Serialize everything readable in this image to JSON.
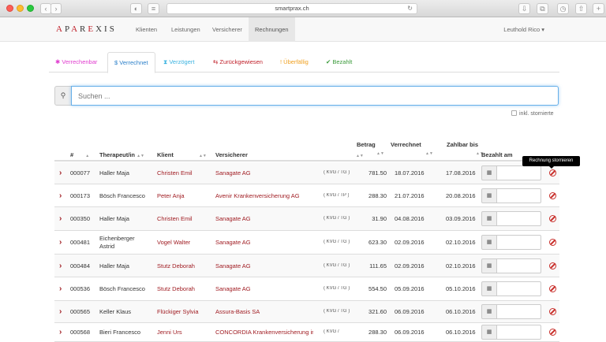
{
  "browser": {
    "url": "smartprax.ch"
  },
  "brand": {
    "logo": "APAREXIS"
  },
  "nav": {
    "items": [
      "Klienten",
      "Leistungen",
      "Versicherer",
      "Rechnungen"
    ],
    "user": "Leuthold Rico ▾"
  },
  "tabs": [
    {
      "label": "✱ Verrechenbar",
      "color": "#e03ccf"
    },
    {
      "label": "$ Verrechnet",
      "color": "#2a7fc9"
    },
    {
      "label": "⧗ Verzögert",
      "color": "#3bb3e0"
    },
    {
      "label": "⇆ Zurückgewiesen",
      "color": "#c0202a"
    },
    {
      "label": "! Überfällig",
      "color": "#f0a020"
    },
    {
      "label": "✔ Bezahlt",
      "color": "#3a9a3a"
    }
  ],
  "search": {
    "placeholder": "Suchen ...",
    "include_cancelled": "inkl. stornierte"
  },
  "table": {
    "headers": [
      "#",
      "Therapeut/in",
      "Klient",
      "Versicherer",
      "Betrag",
      "Verrechnet",
      "Zahlbar bis",
      "Bezahlt am"
    ],
    "tooltip": "Rechnung stornieren",
    "rows": [
      {
        "num": "000077",
        "therapist": "Haller Maja",
        "client": "Christen Emil",
        "insurer": "Sanagate AG",
        "law": "( KVG / TG )",
        "amount": "781.50",
        "billed": "18.07.2016",
        "due": "17.08.2016"
      },
      {
        "num": "000173",
        "therapist": "Bösch Francesco",
        "client": "Peter Anja",
        "insurer": "Avenir Krankenversicherung AG",
        "law": "( KVG / TP )",
        "amount": "288.30",
        "billed": "21.07.2016",
        "due": "20.08.2016"
      },
      {
        "num": "000350",
        "therapist": "Haller Maja",
        "client": "Christen Emil",
        "insurer": "Sanagate AG",
        "law": "( KVG / TG )",
        "amount": "31.90",
        "billed": "04.08.2016",
        "due": "03.09.2016"
      },
      {
        "num": "000481",
        "therapist": "Eichenberger Astrid",
        "client": "Vogel Walter",
        "insurer": "Sanagate AG",
        "law": "( KVG / TG )",
        "amount": "623.30",
        "billed": "02.09.2016",
        "due": "02.10.2016"
      },
      {
        "num": "000484",
        "therapist": "Haller Maja",
        "client": "Stutz Deborah",
        "insurer": "Sanagate AG",
        "law": "( KVG / TG )",
        "amount": "111.65",
        "billed": "02.09.2016",
        "due": "02.10.2016"
      },
      {
        "num": "000536",
        "therapist": "Bösch Francesco",
        "client": "Stutz Deborah",
        "insurer": "Sanagate AG",
        "law": "( KVG / TG )",
        "amount": "554.50",
        "billed": "05.09.2016",
        "due": "05.10.2016"
      },
      {
        "num": "000565",
        "therapist": "Keller Klaus",
        "client": "Flückiger Sylvia",
        "insurer": "Assura-Basis SA",
        "law": "( KVG / TG )",
        "amount": "321.60",
        "billed": "06.09.2016",
        "due": "06.10.2016"
      },
      {
        "num": "000568",
        "therapist": "Bieri Francesco",
        "client": "Jenni Urs",
        "insurer": "CONCORDIA Krankenversicherung inkl. FL",
        "law": "( KVG /",
        "amount": "288.30",
        "billed": "06.09.2016",
        "due": "06.10.2016"
      }
    ]
  }
}
